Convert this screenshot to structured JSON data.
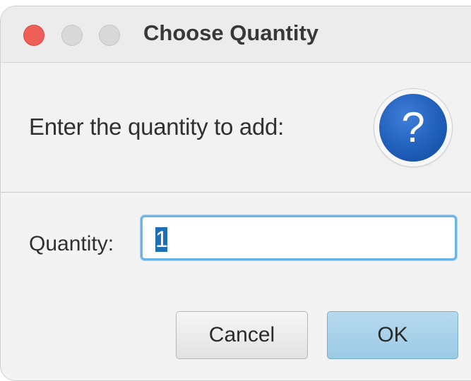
{
  "window": {
    "title": "Choose Quantity"
  },
  "header": {
    "prompt": "Enter the quantity to add:",
    "icon": "question-icon",
    "icon_glyph": "?"
  },
  "form": {
    "quantity_label": "Quantity:",
    "quantity_value": "1"
  },
  "buttons": {
    "cancel_label": "Cancel",
    "ok_label": "OK"
  },
  "colors": {
    "close": "#ee5f57",
    "accent": "#6cb3e6",
    "ok_button": "#a9d2eb",
    "icon_blue": "#1f5fba"
  }
}
